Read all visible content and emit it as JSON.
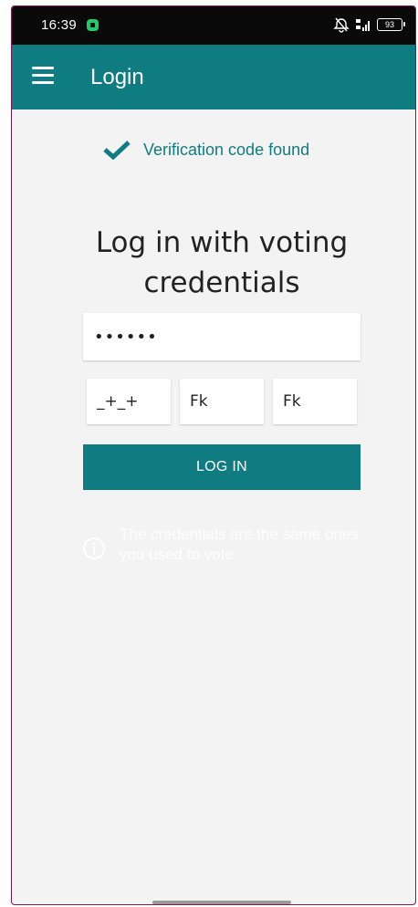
{
  "status_bar": {
    "time": "16:39",
    "battery": "93",
    "icons": [
      "app-notification-icon",
      "alarm-off-icon",
      "signal-4g-icon",
      "battery-icon"
    ]
  },
  "app_bar": {
    "title": "Login",
    "menu_icon": "hamburger-menu-icon"
  },
  "verification": {
    "text": "Verification code found",
    "icon": "checkmark-icon"
  },
  "heading": "Log in with voting credentials",
  "form": {
    "password_value": "••••••",
    "credential_parts": [
      "_+_+",
      "Fk",
      "Fk"
    ],
    "login_label": "LOG IN"
  },
  "info": {
    "icon": "info-icon",
    "text": "The credentials are the same ones you used to vote."
  },
  "colors": {
    "primary": "#0f7c81",
    "background": "#f3f3f3",
    "status_bar": "#0a0a0a"
  }
}
